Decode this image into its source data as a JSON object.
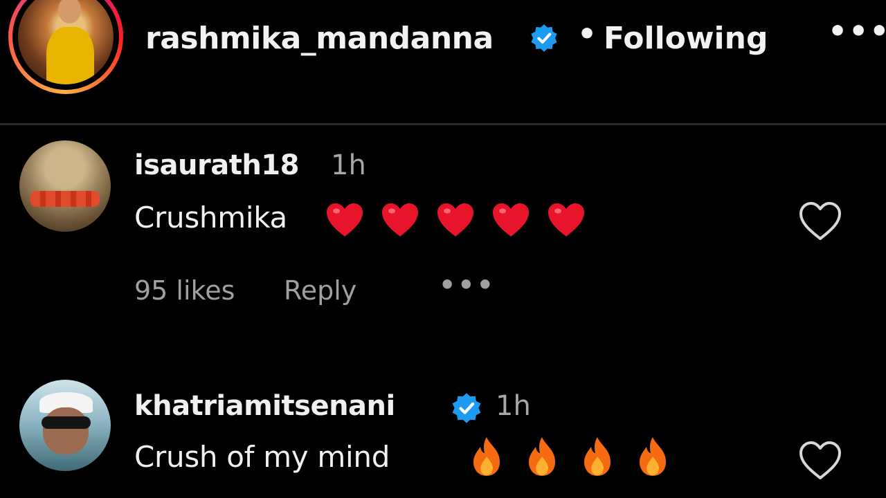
{
  "post_header": {
    "username": "rashmika_mandanna",
    "verified": true,
    "separator": "•",
    "follow_status": "Following",
    "more_label": "•••"
  },
  "comments": [
    {
      "username": "isaurath18",
      "verified": false,
      "time": "1h",
      "text": "Crushmika",
      "emojis": [
        "❤️",
        "❤️",
        "❤️",
        "❤️",
        "❤️"
      ],
      "likes": "95 likes",
      "reply": "Reply",
      "more": "•••"
    },
    {
      "username": "khatriamitsenani",
      "verified": true,
      "time": "1h",
      "text": "Crush of my mind",
      "emojis": [
        "🔥",
        "🔥",
        "🔥",
        "🔥"
      ]
    }
  ],
  "colors": {
    "background": "#000000",
    "verified_badge": "#1d9bf0",
    "heart_emoji": "#e8142b",
    "fire_emoji": "#f46b12",
    "muted_text": "#a8a8a8"
  }
}
